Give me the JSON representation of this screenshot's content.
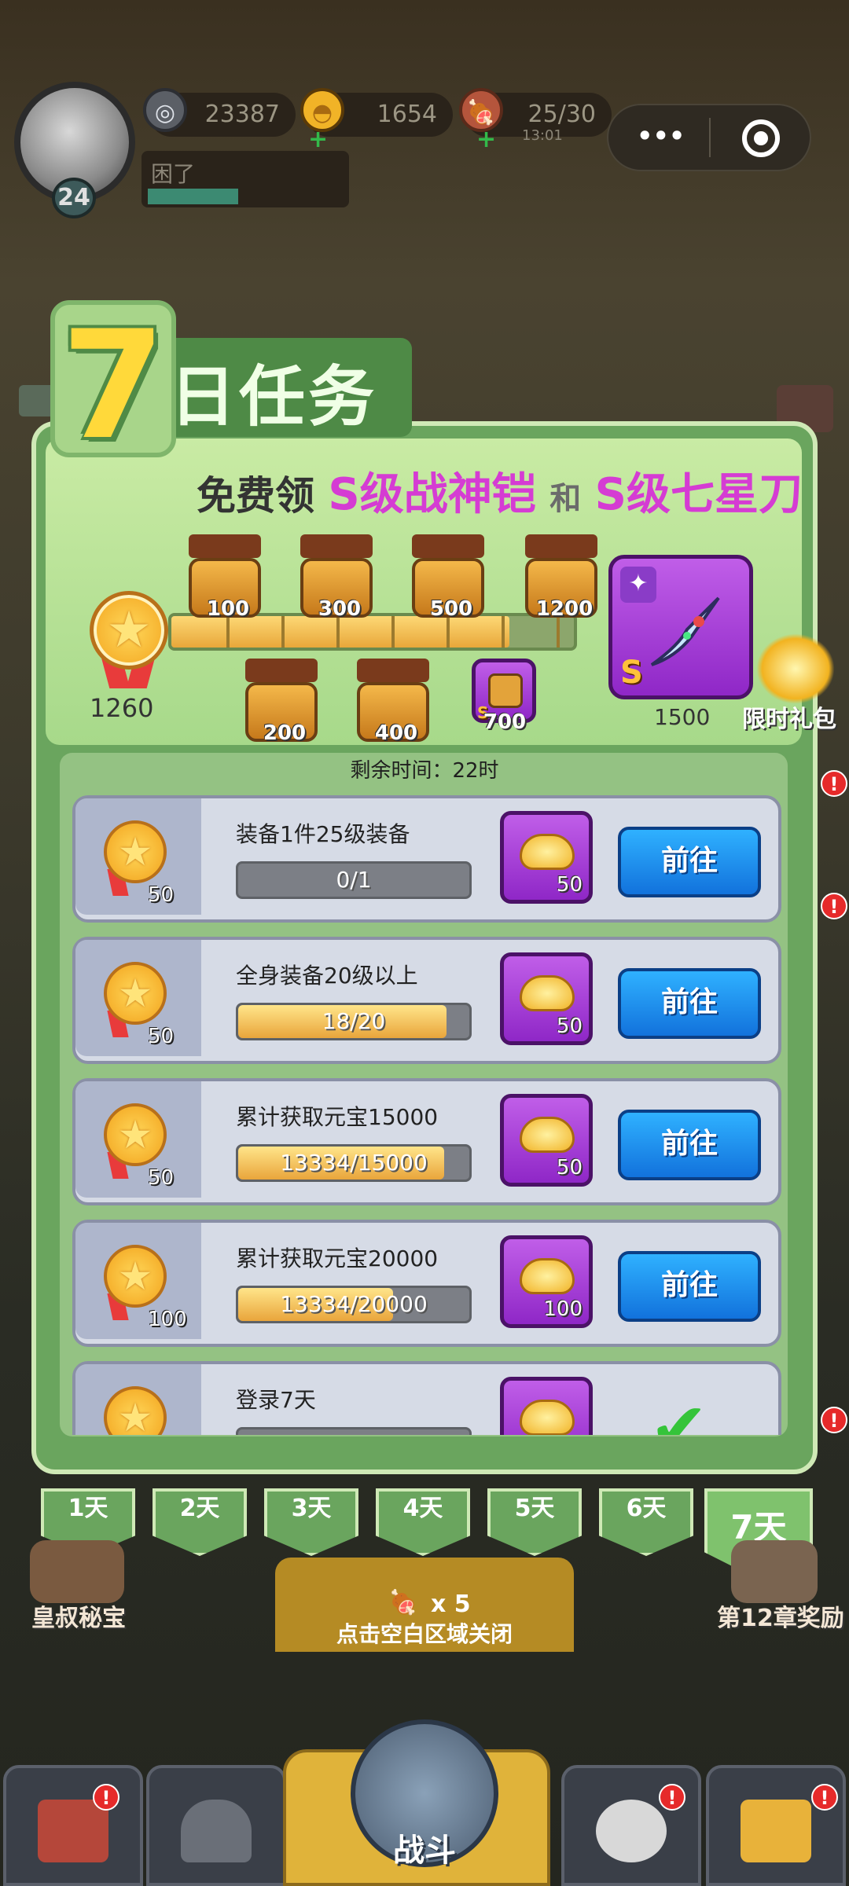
{
  "topbar": {
    "level": "24",
    "silver": "23387",
    "gold": "1654",
    "stamina": "25/30",
    "stamina_timer": "13:01",
    "status": "困了",
    "menu_dots": "•••"
  },
  "header": {
    "number": "7",
    "title": "日任务",
    "subtitle_pre": "免费领",
    "reward1": "S级战神铠",
    "subtitle_and": "和",
    "reward2": "S级七星刀"
  },
  "progress": {
    "current_points": "1260",
    "max_points": 1500,
    "fill_fraction": 0.84,
    "milestones_top": [
      "100",
      "300",
      "500",
      "1200"
    ],
    "milestones_bottom": [
      "200",
      "400",
      "700"
    ],
    "final_milestone": "1500",
    "final_grade": "S",
    "armor_grade": "S",
    "gift_label": "限时礼包"
  },
  "timer_text": "剩余时间：22时",
  "tasks": [
    {
      "title": "装备1件25级装备",
      "points": "50",
      "progress_text": "0/1",
      "progress": 0.0,
      "reward": "50",
      "button": "前往"
    },
    {
      "title": "全身装备20级以上",
      "points": "50",
      "progress_text": "18/20",
      "progress": 0.9,
      "reward": "50",
      "button": "前往"
    },
    {
      "title": "累计获取元宝15000",
      "points": "50",
      "progress_text": "13334/15000",
      "progress": 0.89,
      "reward": "50",
      "button": "前往"
    },
    {
      "title": "累计获取元宝20000",
      "points": "100",
      "progress_text": "13334/20000",
      "progress": 0.67,
      "reward": "100",
      "button": "前往"
    },
    {
      "title": "登录7天",
      "points": "",
      "progress_text": "",
      "progress": 0.0,
      "reward": "",
      "button": ""
    }
  ],
  "days": [
    "1天",
    "2天",
    "3天",
    "4天",
    "5天",
    "6天",
    "7天"
  ],
  "active_day_index": 6,
  "background": {
    "left_label": "皇叔秘宝",
    "right_label": "第12章奖励",
    "cost_text": "x 5",
    "battle_label": "战斗"
  },
  "close_hint": "点击空白区域关闭",
  "badge": "!"
}
